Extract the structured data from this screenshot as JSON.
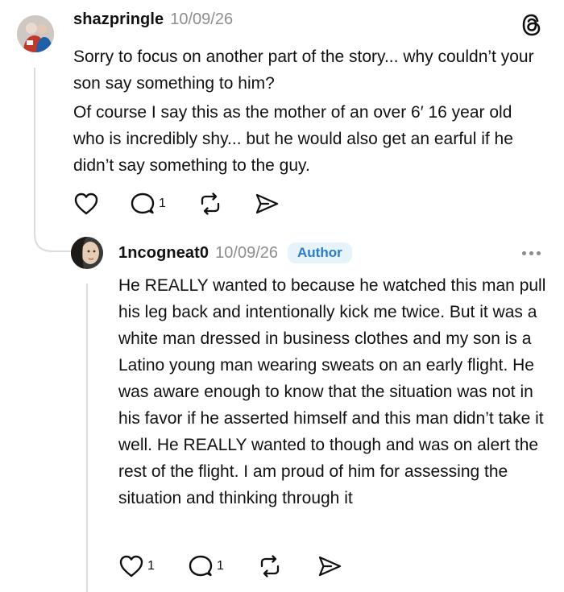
{
  "comment": {
    "username": "shazpringle",
    "timestamp": "10/09/26",
    "paragraphs": [
      "Sorry to focus on another part of the story... why couldn’t your son say something to him?",
      "Of course I say this as the mother of an over 6′ 16 year old who is incredibly shy... but he would also get an earful if he didn’t say something to the guy."
    ],
    "actions": {
      "like_count": "",
      "reply_count": "1"
    }
  },
  "reply": {
    "username": "1ncogneat0",
    "timestamp": "10/09/26",
    "badge": "Author",
    "text": "He REALLY wanted to because he watched this man pull his leg back and intentionally kick me twice. But it was a white man dressed in business clothes and my son is a Latino young man wearing sweats on an early flight. He was aware enough to know that the situation was not in his favor if he asserted himself and this man didn’t take it well. He REALLY wanted to though and was on alert the rest of the flight. I am proud of him for assessing the situation and thinking through it",
    "actions": {
      "like_count": "1",
      "reply_count": "1"
    }
  },
  "icons": {
    "app": "threads-icon",
    "like": "heart-icon",
    "reply": "comment-icon",
    "repost": "repost-icon",
    "share": "share-icon",
    "more": "more-icon"
  },
  "colors": {
    "accent": "#2a7cc7",
    "badge_bg": "#e6f3fb",
    "muted": "#8e8e8e"
  }
}
